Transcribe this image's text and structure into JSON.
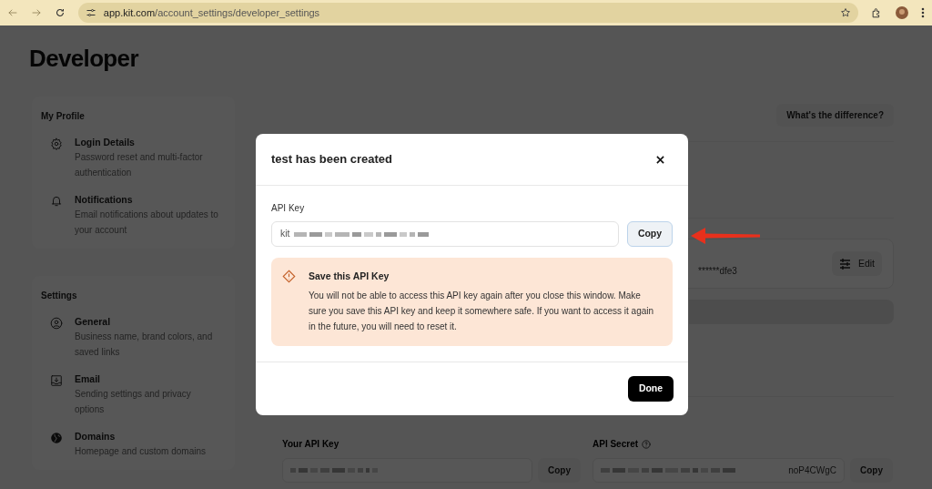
{
  "browser": {
    "url_host": "app.kit.com",
    "url_path": "/account_settings/developer_settings"
  },
  "page_title": "Developer",
  "sidebar": [
    {
      "heading": "My Profile",
      "items": [
        {
          "kind": "gear",
          "title": "Login Details",
          "description": "Password reset and multi-factor authentication"
        },
        {
          "kind": "bell",
          "title": "Notifications",
          "description": "Email notifications about updates to your account"
        }
      ]
    },
    {
      "heading": "Settings",
      "items": [
        {
          "kind": "user",
          "title": "General",
          "description": "Business name, brand colors, and saved links"
        },
        {
          "kind": "inbox",
          "title": "Email",
          "description": "Sending settings and privacy options"
        },
        {
          "kind": "globe",
          "title": "Domains",
          "description": "Homepage and custom domains"
        }
      ]
    }
  ],
  "main": {
    "difference_button": "What's the difference?",
    "key_card": {
      "masked_key": "******dfe3",
      "edit_button": "Edit"
    },
    "api_key": {
      "label": "Your API Key",
      "copy_button": "Copy"
    },
    "api_secret": {
      "label": "API Secret",
      "value_end": "noP4CWgC",
      "copy_button": "Copy"
    }
  },
  "modal": {
    "title": "test has been created",
    "field_label": "API Key",
    "key_prefix": "kit",
    "copy_button": "Copy",
    "warning": {
      "title": "Save this API Key",
      "body": "You will not be able to access this API key again after you close this window. Make sure you save this API key and keep it somewhere safe. If you want to access it again in the future, you will need to reset it."
    },
    "done_button": "Done"
  }
}
